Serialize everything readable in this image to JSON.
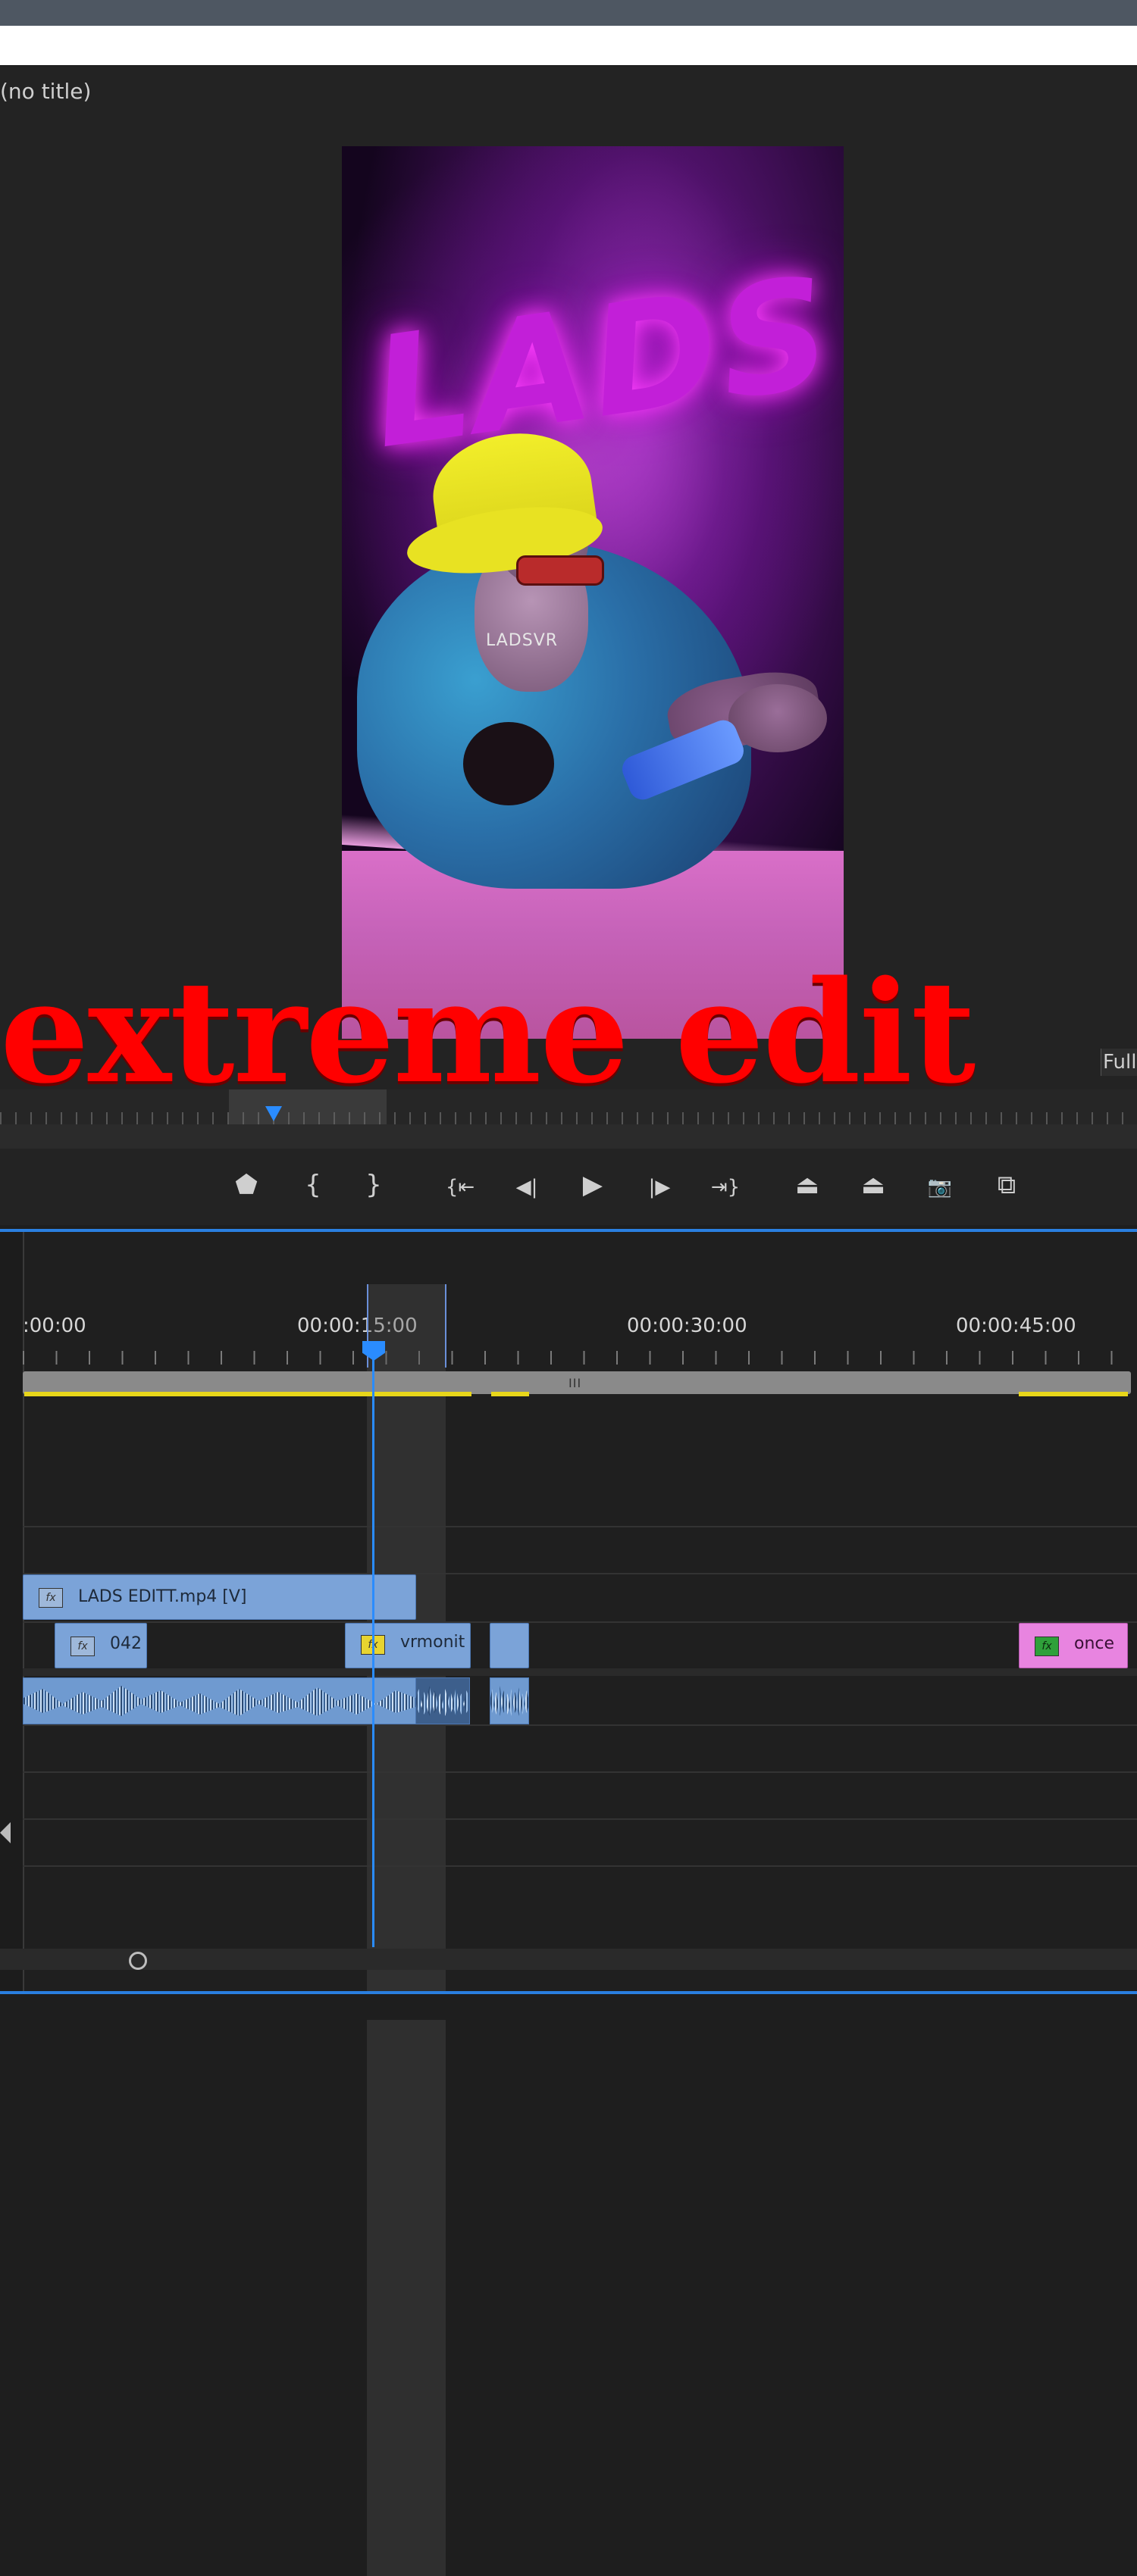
{
  "monitor": {
    "title": "(no title)",
    "fit_label": "Full",
    "overlay_caption": "extreme edit",
    "frame_text": {
      "graffiti": "LADS",
      "shirt": "LADSVR"
    }
  },
  "transport": {
    "buttons": [
      {
        "name": "add-marker-button",
        "icon": "marker-icon",
        "glyph": "⬟"
      },
      {
        "name": "mark-in-button",
        "icon": "mark-in-icon",
        "glyph": "{"
      },
      {
        "name": "mark-out-button",
        "icon": "mark-out-icon",
        "glyph": "}"
      },
      {
        "name": "go-to-in-button",
        "icon": "go-to-in-icon",
        "glyph": "{⇤"
      },
      {
        "name": "step-back-button",
        "icon": "step-back-icon",
        "glyph": "◀|"
      },
      {
        "name": "play-button",
        "icon": "play-icon",
        "glyph": "▶"
      },
      {
        "name": "step-forward-button",
        "icon": "step-forward-icon",
        "glyph": "|▶"
      },
      {
        "name": "go-to-out-button",
        "icon": "go-to-out-icon",
        "glyph": "⇥}"
      },
      {
        "name": "lift-button",
        "icon": "lift-icon",
        "glyph": "⏏"
      },
      {
        "name": "extract-button",
        "icon": "extract-icon",
        "glyph": "⏏"
      },
      {
        "name": "export-frame-button",
        "icon": "camera-icon",
        "glyph": "📷"
      },
      {
        "name": "comparison-view-button",
        "icon": "comparison-icon",
        "glyph": "⧉"
      }
    ]
  },
  "timeline": {
    "timecodes": [
      ":00:00",
      "00:00:15:00",
      "00:00:30:00",
      "00:00:45:00"
    ],
    "zoom_grip": "III",
    "video_clips": [
      {
        "label": "LADS EDITT.mp4 [V]",
        "fx": "fx",
        "color": "#7ba3d8"
      },
      {
        "label": "042",
        "fx": "fx",
        "color": "#7ba3d8"
      },
      {
        "label": "vrmonit",
        "fx": "fx",
        "color": "#7ba3d8"
      },
      {
        "label": "",
        "fx": "",
        "color": "#7ba3d8"
      },
      {
        "label": "once",
        "fx": "fx",
        "color": "#e884e0"
      }
    ],
    "playhead_color": "#2a8cff",
    "accent_color": "#2a7fe0"
  }
}
